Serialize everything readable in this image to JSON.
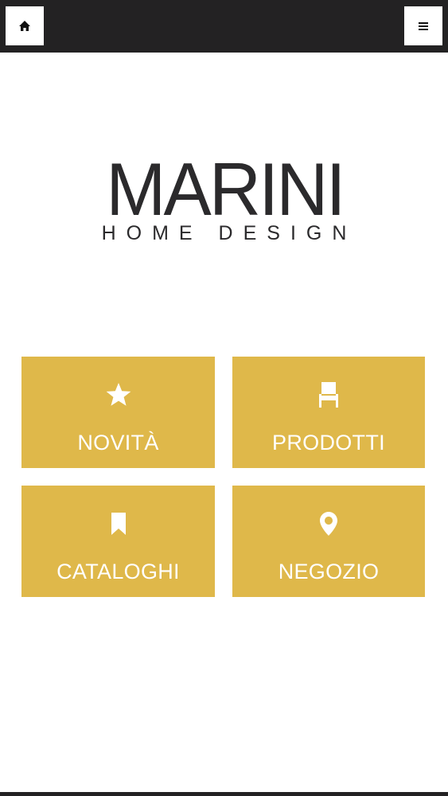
{
  "header": {
    "home_icon": "home-icon",
    "menu_icon": "hamburger-menu-icon"
  },
  "logo": {
    "name": "MARINI",
    "tagline": "HOME DESIGN"
  },
  "tiles": [
    {
      "label": "NOVITÀ",
      "icon": "star-icon"
    },
    {
      "label": "PRODOTTI",
      "icon": "chair-icon"
    },
    {
      "label": "CATALOGHI",
      "icon": "bookmark-icon"
    },
    {
      "label": "NEGOZIO",
      "icon": "map-pin-icon"
    }
  ],
  "colors": {
    "topbar": "#232223",
    "tile": "#dfb84a",
    "logo": "#2b2a2c"
  }
}
